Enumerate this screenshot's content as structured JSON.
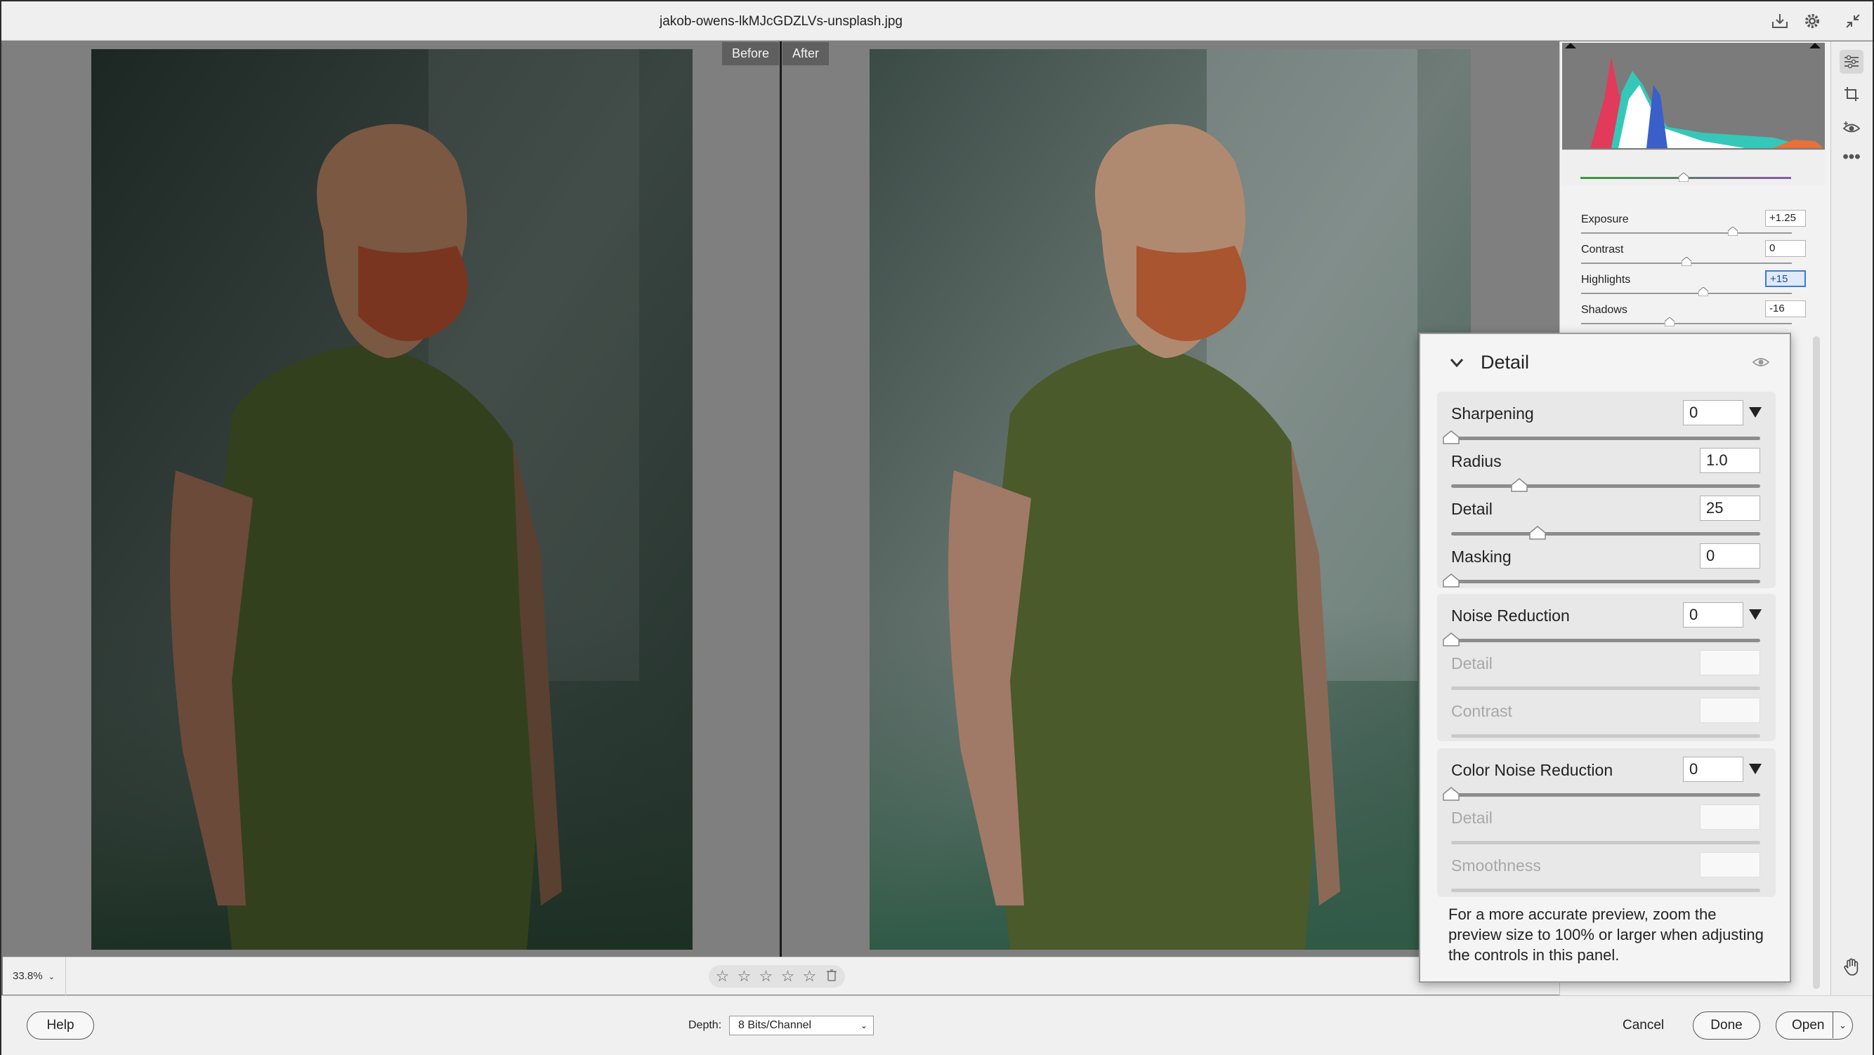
{
  "window": {
    "title": "jakob-owens-lkMJcGDZLVs-unsplash.jpg"
  },
  "compare": {
    "before_label": "Before",
    "after_label": "After"
  },
  "status": {
    "zoom": "33.8%",
    "rating_stars": 5
  },
  "footer": {
    "help": "Help",
    "depth_label": "Depth:",
    "depth_value": "8 Bits/Channel",
    "cancel": "Cancel",
    "done": "Done",
    "open": "Open"
  },
  "basic": {
    "rows": [
      {
        "label": "Exposure",
        "value": "+1.25",
        "level": 0.72
      },
      {
        "label": "Contrast",
        "value": "0",
        "level": 0.5
      },
      {
        "label": "Highlights",
        "value": "+15",
        "level": 0.58,
        "selected": true
      },
      {
        "label": "Shadows",
        "value": "-16",
        "level": 0.42
      }
    ]
  },
  "detail": {
    "title": "Detail",
    "sharpening": {
      "label": "Sharpening",
      "value": "0",
      "level": 0,
      "rows": [
        {
          "label": "Radius",
          "value": "1.0",
          "level": 0.22
        },
        {
          "label": "Detail",
          "value": "25",
          "level": 0.28
        },
        {
          "label": "Masking",
          "value": "0",
          "level": 0
        }
      ]
    },
    "noise": {
      "label": "Noise Reduction",
      "value": "0",
      "level": 0,
      "rows": [
        {
          "label": "Detail"
        },
        {
          "label": "Contrast"
        }
      ]
    },
    "color_noise": {
      "label": "Color Noise Reduction",
      "value": "0",
      "level": 0,
      "rows": [
        {
          "label": "Detail"
        },
        {
          "label": "Smoothness"
        }
      ]
    },
    "note": "For a more accurate preview, zoom the preview size to 100% or larger when adjusting the controls in this panel."
  },
  "icons": {
    "titlebar": [
      "save-icon",
      "gear-icon",
      "collapse-icon"
    ],
    "tools": [
      "edit-sliders-icon",
      "crop-icon",
      "red-eye-icon",
      "more-icon"
    ],
    "canvas_tool": "hand-icon"
  }
}
